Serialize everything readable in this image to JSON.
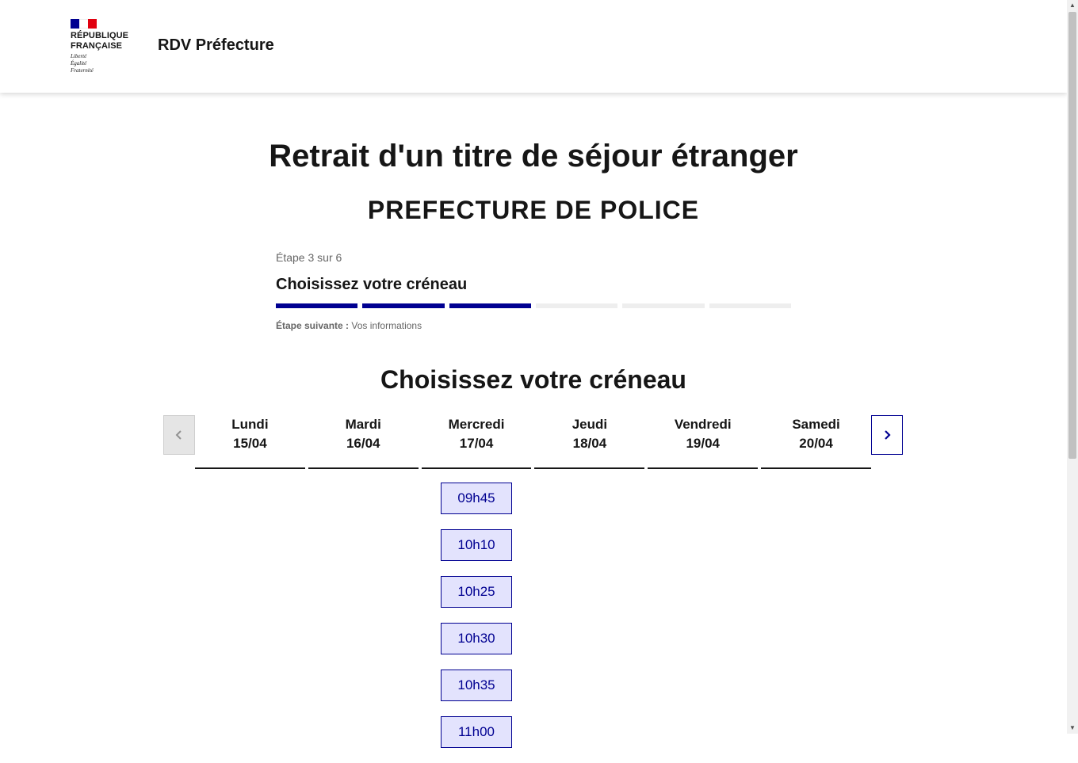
{
  "header": {
    "logo_name": "RÉPUBLIQUE\nFRANÇAISE",
    "logo_motto": "Liberté\nÉgalité\nFraternité",
    "service_title": "RDV Préfecture"
  },
  "page": {
    "title": "Retrait d'un titre de séjour étranger",
    "prefecture": "PREFECTURE DE POLICE"
  },
  "stepper": {
    "state": "Étape 3 sur 6",
    "title": "Choisissez votre créneau",
    "total_steps": 6,
    "current_step": 3,
    "next_label": "Étape suivante :",
    "next_value": "Vos informations"
  },
  "calendar": {
    "title": "Choisissez votre créneau",
    "days": [
      {
        "name": "Lundi",
        "date": "15/04"
      },
      {
        "name": "Mardi",
        "date": "16/04"
      },
      {
        "name": "Mercredi",
        "date": "17/04"
      },
      {
        "name": "Jeudi",
        "date": "18/04"
      },
      {
        "name": "Vendredi",
        "date": "19/04"
      },
      {
        "name": "Samedi",
        "date": "20/04"
      }
    ],
    "slots_day": "Mercredi 17/04",
    "slots": [
      "09h45",
      "10h10",
      "10h25",
      "10h30",
      "10h35",
      "11h00"
    ]
  },
  "colors": {
    "primary": "#000091",
    "slot_bg": "#e3e3fd",
    "flag_blue": "#000091",
    "flag_red": "#e1000f"
  },
  "icons": {
    "prev": "chevron-left-icon",
    "next": "chevron-right-icon"
  }
}
